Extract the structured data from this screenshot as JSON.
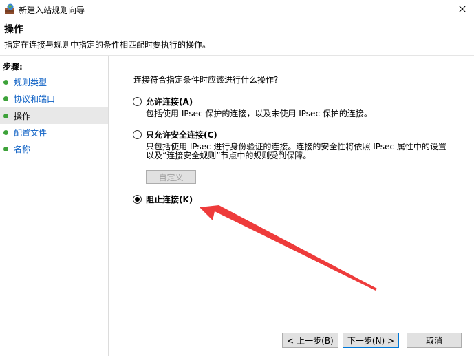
{
  "window": {
    "title": "新建入站规则向导",
    "icon": "firewall-icon"
  },
  "header": {
    "title": "操作",
    "description": "指定在连接与规则中指定的条件相匹配时要执行的操作。"
  },
  "steps": {
    "heading": "步骤:",
    "items": [
      {
        "label": "规则类型",
        "active": false
      },
      {
        "label": "协议和端口",
        "active": false
      },
      {
        "label": "操作",
        "active": true
      },
      {
        "label": "配置文件",
        "active": false
      },
      {
        "label": "名称",
        "active": false
      }
    ]
  },
  "main": {
    "question": "连接符合指定条件时应该进行什么操作?",
    "options": [
      {
        "label": "允许连接(A)",
        "description": "包括使用 IPsec 保护的连接，以及未使用 IPsec 保护的连接。",
        "checked": false
      },
      {
        "label": "只允许安全连接(C)",
        "description": "只包括使用 IPsec 进行身份验证的连接。连接的安全性将依照 IPsec 属性中的设置以及“连接安全规则”节点中的规则受到保障。",
        "checked": false
      },
      {
        "label": "阻止连接(K)",
        "description": "",
        "checked": true
      }
    ],
    "customize_label": "自定义"
  },
  "buttons": {
    "back": "< 上一步(B)",
    "next": "下一步(N) >",
    "cancel": "取消"
  },
  "colors": {
    "step_dot": "#3da23a",
    "step_link": "#0b5fc4",
    "annotation_arrow": "#ee3b3b",
    "primary_border": "#0078d7"
  }
}
